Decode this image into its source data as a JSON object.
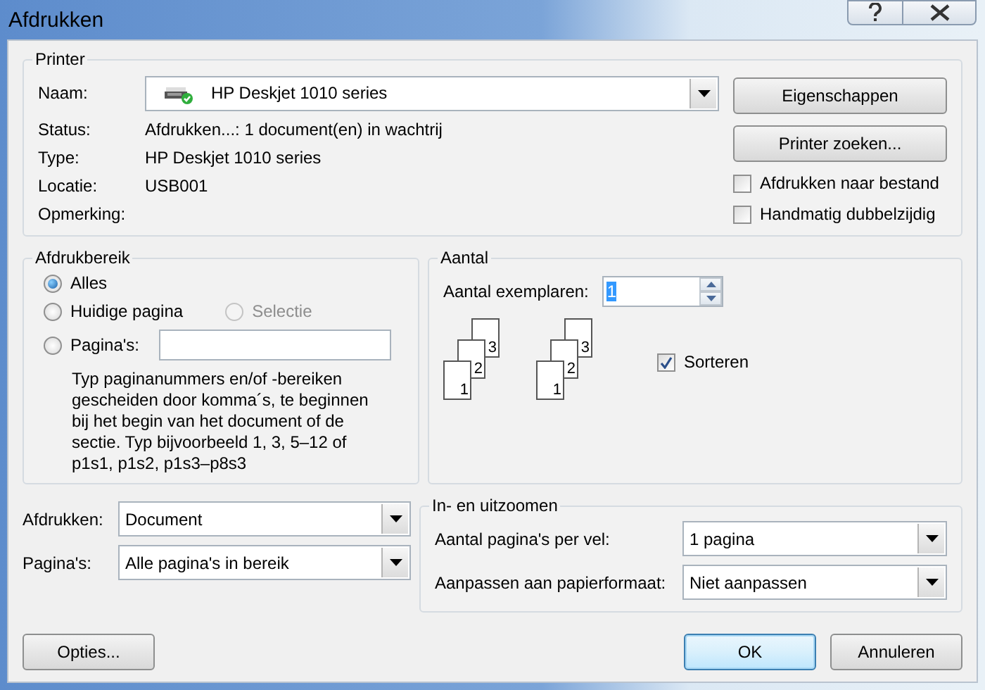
{
  "window": {
    "title": "Afdrukken"
  },
  "printer": {
    "legend": "Printer",
    "name_label": "Naam:",
    "name_value": "HP Deskjet 1010 series",
    "info": [
      {
        "label": "Status:",
        "value": "Afdrukken...: 1 document(en) in wachtrij"
      },
      {
        "label": "Type:",
        "value": "HP Deskjet 1010 series"
      },
      {
        "label": "Locatie:",
        "value": "USB001"
      },
      {
        "label": "Opmerking:"
      }
    ],
    "buttons": [
      "Eigenschappen",
      "Printer zoeken..."
    ],
    "options": [
      {
        "label": "Afdrukken naar bestand",
        "checked": false
      },
      {
        "label": "Handmatig dubbelzijdig",
        "checked": false
      }
    ]
  },
  "range": {
    "legend": "Afdrukbereik",
    "options": [
      {
        "label": "Alles",
        "selected": true,
        "disabled": false
      },
      {
        "label": "Huidige pagina",
        "selected": false,
        "disabled": false
      },
      {
        "label": "Selectie",
        "selected": false,
        "disabled": true
      },
      {
        "label": "Pagina's:",
        "selected": false,
        "disabled": false
      }
    ],
    "hint": "Typ paginanummers en/of -bereiken gescheiden door komma´s, te beginnen bij het begin van het document of de sectie. Typ bijvoorbeeld 1, 3, 5–12 of p1s1, p1s2, p1s3–p8s3"
  },
  "copies": {
    "legend": "Aantal",
    "label": "Aantal exemplaren:",
    "value": "1",
    "stacks": [
      [
        "3",
        "2",
        "1"
      ],
      [
        "3",
        "2",
        "1"
      ]
    ],
    "sort": {
      "label": "Sorteren",
      "checked": true
    }
  },
  "print_what": [
    {
      "label": "Afdrukken:",
      "value": "Document"
    },
    {
      "label": "Pagina's:",
      "value": "Alle pagina's in bereik"
    }
  ],
  "zoom": {
    "legend": "In- en uitzoomen",
    "rows": [
      {
        "label": "Aantal pagina's per vel:",
        "value": "1 pagina"
      },
      {
        "label": "Aanpassen aan papierformaat:",
        "value": "Niet aanpassen"
      }
    ]
  },
  "buttons": [
    {
      "label": "Opties...",
      "default": false
    },
    {
      "label": "OK",
      "default": true
    },
    {
      "label": "Annuleren",
      "default": false
    }
  ]
}
